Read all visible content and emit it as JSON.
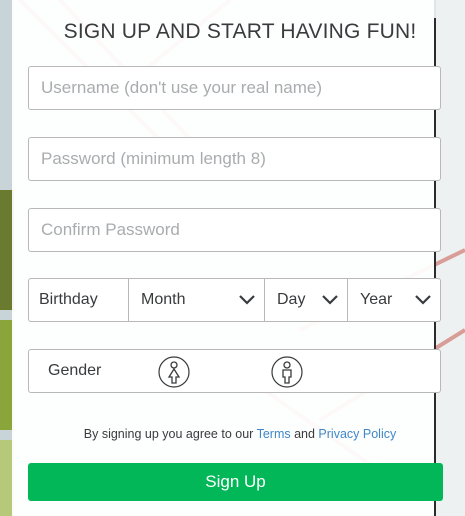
{
  "form": {
    "title": "SIGN UP AND START HAVING FUN!",
    "username_placeholder": "Username (don't use your real name)",
    "password_placeholder": "Password (minimum length 8)",
    "confirm_placeholder": "Confirm Password",
    "birthday_label": "Birthday",
    "month_label": "Month",
    "day_label": "Day",
    "year_label": "Year",
    "gender_label": "Gender",
    "female_icon": "female-gender-icon",
    "male_icon": "male-gender-icon",
    "agree_prefix": "By signing up you agree to our ",
    "terms_link": "Terms",
    "agree_and": " and ",
    "privacy_link": "Privacy Policy",
    "signup_button": "Sign Up"
  },
  "colors": {
    "accent_green": "#02b757",
    "link_blue": "#3f87c7",
    "text": "#393b3d",
    "border": "#b8b8b8"
  }
}
